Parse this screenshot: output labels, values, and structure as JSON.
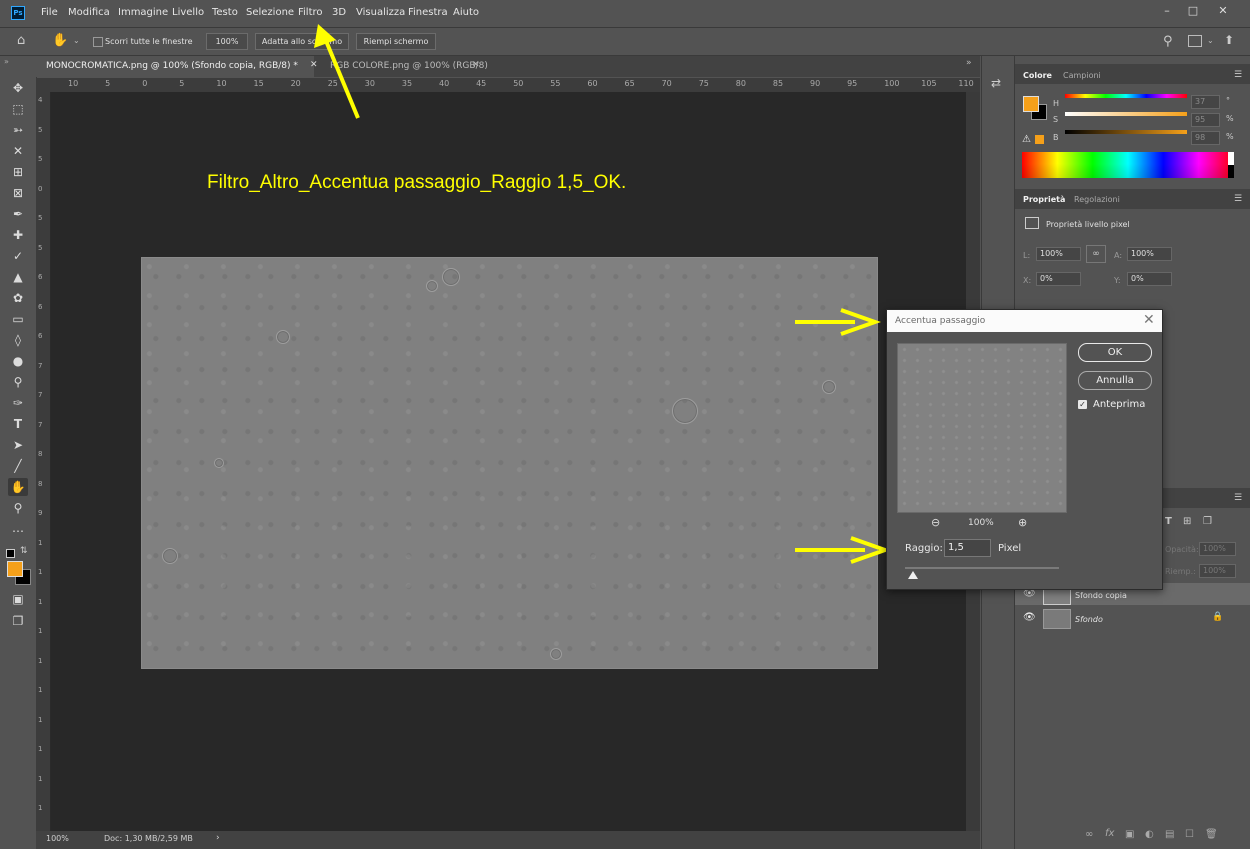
{
  "app": {
    "logo_text": "Ps"
  },
  "menu": [
    "File",
    "Modifica",
    "Immagine",
    "Livello",
    "Testo",
    "Selezione",
    "Filtro",
    "3D",
    "Visualizza",
    "Finestra",
    "Aiuto"
  ],
  "options": {
    "scroll_all_label": "Scorri tutte le finestre",
    "zoom_value": "100%",
    "fit_label": "Adatta allo schermo",
    "fill_label": "Riempi schermo"
  },
  "tabs": [
    {
      "label": "MONOCROMATICA.png @ 100% (Sfondo copia, RGB/8) *",
      "active": true
    },
    {
      "label": "RGB COLORE.png @ 100% (RGB/8)",
      "active": false
    }
  ],
  "ruler_h": [
    "10",
    "5",
    "0",
    "5",
    "10",
    "15",
    "20",
    "25",
    "30",
    "35",
    "40",
    "45",
    "50",
    "55",
    "60",
    "65",
    "70",
    "75",
    "80",
    "85",
    "90",
    "95",
    "100",
    "105",
    "110"
  ],
  "ruler_v": [
    "4",
    "5",
    "5",
    "0",
    "5",
    "5",
    "6",
    "6",
    "6",
    "7",
    "7",
    "7",
    "8",
    "8",
    "9",
    "1",
    "1",
    "1",
    "1",
    "1",
    "1",
    "1",
    "1",
    "1",
    "1"
  ],
  "annotation": {
    "text": "Filtro_Altro_Accentua passaggio_Raggio 1,5_OK.",
    "color": "#ffff00"
  },
  "status": {
    "zoom": "100%",
    "doc": "Doc: 1,30 MB/2,59 MB"
  },
  "color_panel": {
    "tabs": [
      "Colore",
      "Campioni"
    ],
    "fg_color": "#f5a01a",
    "bg_color": "#000000",
    "sliders": [
      {
        "label": "H",
        "value": "37",
        "unit": "°"
      },
      {
        "label": "S",
        "value": "95",
        "unit": "%"
      },
      {
        "label": "B",
        "value": "98",
        "unit": "%"
      }
    ]
  },
  "properties_panel": {
    "tabs": [
      "Proprietà",
      "Regolazioni"
    ],
    "section": "Proprietà livello pixel",
    "fields": [
      {
        "label": "L:",
        "value": "100%"
      },
      {
        "label": "A:",
        "value": "100%"
      },
      {
        "label": "X:",
        "value": "0%"
      },
      {
        "label": "Y:",
        "value": "0%"
      }
    ]
  },
  "layers_panel": {
    "opacity_label": "Opacità:",
    "opacity_value": "100%",
    "fill_label": "Riemp.:",
    "fill_value": "100%",
    "layers": [
      {
        "name": "Sfondo copia",
        "selected": true
      },
      {
        "name": "Sfondo",
        "selected": false,
        "locked": true
      }
    ]
  },
  "dialog": {
    "title": "Accentua passaggio",
    "ok_label": "OK",
    "cancel_label": "Annulla",
    "preview_label": "Anteprima",
    "preview_checked": true,
    "zoom": "100%",
    "radius_label": "Raggio:",
    "radius_value": "1,5",
    "radius_unit": "Pixel",
    "radius_slider": 0.05
  },
  "colors": {
    "accent_arrow": "#ffff00",
    "canvas_bg": "#282828",
    "panel_bg": "#535353"
  }
}
